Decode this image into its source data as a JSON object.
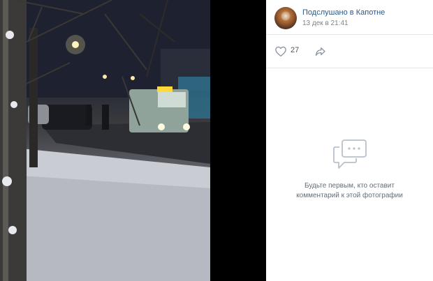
{
  "post": {
    "group_name": "Подслушано в Капотне",
    "date": "13 дек в 21:41",
    "avatar_icon": "group-avatar"
  },
  "actions": {
    "like_count": "27",
    "like_icon": "heart-icon",
    "share_icon": "share-icon"
  },
  "comments": {
    "empty_line1": "Будьте первым, кто оставит",
    "empty_line2": "комментарий к этой фотографии",
    "icon": "comment-bubble-icon"
  },
  "colors": {
    "link": "#2a5885",
    "muted": "#828282",
    "divider": "#e7e8ec",
    "icon": "#aeb7c2"
  }
}
